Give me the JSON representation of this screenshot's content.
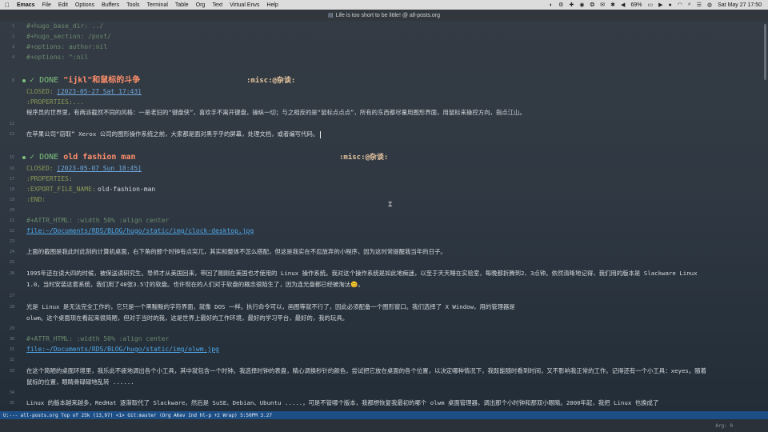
{
  "menubar": {
    "app": "Emacs",
    "items": [
      "File",
      "Edit",
      "Options",
      "Buffers",
      "Tools",
      "Terminal",
      "Table",
      "Org",
      "Text",
      "Virtual Envs",
      "Help"
    ],
    "battery": "69%",
    "datetime": "Sat May 27  17:50"
  },
  "window": {
    "title": "Life is too short to be little! @ all-posts.org"
  },
  "editor": {
    "lines": [
      {
        "text": "#+hugo_base_dir: ../",
        "style": "meta"
      },
      {
        "text": "#+hugo_section: /post/",
        "style": "meta"
      },
      {
        "text": "#+options: author:nil",
        "style": "meta"
      },
      {
        "text": "#+options: ^:nil",
        "style": "meta"
      }
    ],
    "heading1": {
      "line_no": "8",
      "keyword": "DONE",
      "title": "\"ijkl\"和鼠标的斗争",
      "tags": ":misc:@杂谈:"
    },
    "closed1_label": "CLOSED:",
    "closed1_date": "[2023-05-27 Sat 17:43]",
    "props1": ":PROPERTIES:...",
    "para1": "程序员的世界里，有两派截然不同的风格：一是老旧的“键盘侠”，喜欢手不离开键盘，操纵一切；与之相反的是“鼠标点点点”，所有的东西都尽量用图形界面，用鼠标来操控方向，指点江山。",
    "para2": "在苹果公司“窃取” Xerox 公司的图形操作系统之前，大家都是面对黑乎乎的屏幕，处理文档，或者编写代码。",
    "para2_line_no": "13",
    "heading2": {
      "line_no": "15",
      "keyword": "DONE",
      "title": "old fashion man",
      "tags": ":misc:@杂谈:"
    },
    "closed2_label": "CLOSED:",
    "closed2_date": "[2023-05-07 Sun 18:45]",
    "props2": ":PROPERTIES:",
    "export_key": ":EXPORT_FILE_NAME:",
    "export_val": "old-fashion-man",
    "end": ":END:",
    "attr1": "#+ATTR_HTML: :width 50% :align center",
    "link1": "file:~/Documents/RDS/BLOG/hugo/static/img/clock-desktop.jpg",
    "link1_line_no": "22",
    "para3": "上面的截图是我此时此刻的计算机桌面，右下角的那个时钟有点突兀，其实和整体不怎么搭配，但这是我实在不忍放弃的小程序，因为这时常提醒我当年的日子。",
    "para4a": "1995年还在读大四的时候，被保送读研究生。导师才从美国回来，带回了刚刚在美国也才使用的 Linux 操作系统。我对这个操作系统是如此地痴迷，以至于天天睡在实验室，每晚都折腾到2、3点钟。依然清晰地记得，我们用的版本是 Slackware Linux",
    "para4b": "1.0，当时安装这套系统，我们用了48张3.5寸的软盘。也许现在的人们对于软盘的概念很陌生了，因为连光盘都已经被淘汰😊。",
    "para5a": "光是 Linux 是无法完全工作的，它只是一个黑黢黢的字符界面，就像 DOS 一样。执行命令可以，画图等就不行了，因此必须配备一个图形窗口。我们选择了 X Window，用的管理器是",
    "para5b": "olwm。这个桌面现在看起来很简陋，但对于当时的我，这是世界上最好的工作环境，最好的学习平台，最好的，我的玩具。",
    "attr2": "#+ATTR_HTML: :width 50% :align center",
    "link2": "file:~/Documents/RDS/BLOG/hugo/static/img/olwm.jpg",
    "para6a": "在这个简陋的桌面环境里，我乐此不疲地调出各个小工具，其中就包含一个时钟。我选择时钟的表盘，精心调换秒针的颜色，尝试把它放在桌面的各个位置，以决定哪种情况下，我既能随时看到时间，又不影响我正常的工作。记得还有一个小工具：xeyes。随着",
    "para6b": "鼠标的位置，眼睛骨碌碌地乱转 ......",
    "para7": "Linux 的版本越来越多，RedHat 逐渐取代了 Slackware，然后是 SuSE、Debian、Ubuntu .....，可是不管哪个版本，我都想恢复我最初的哪个 olwm 桌面管理器，调出那个小时钟和那双小眼睛。2000年起，我把 Linux 也换成了",
    "line_nums": {
      "l12": "12",
      "l1": "1",
      "l2": "2",
      "l3": "3",
      "l4": "4",
      "l5": "5",
      "l16": "16",
      "l17": "17",
      "l18": "18",
      "l19": "19",
      "l20": "20",
      "l21": "21",
      "l24": "24",
      "l25": "25",
      "l26": "26",
      "l27": "27",
      "l28": "28",
      "l29": "29",
      "l30": "30",
      "l31": "31",
      "l32": "32",
      "l33": "33",
      "l34": "34",
      "l35": "35",
      "l36": "36",
      "l23": "23"
    }
  },
  "modeline": {
    "text": "U:---  all-posts.org   Top of 25k  (13,97)   <1>  Git:master  (Org AKev Ind hl-p +2 Wrap) 5:50PM 3.27"
  },
  "echo": {
    "hint": "Arg: 0"
  }
}
